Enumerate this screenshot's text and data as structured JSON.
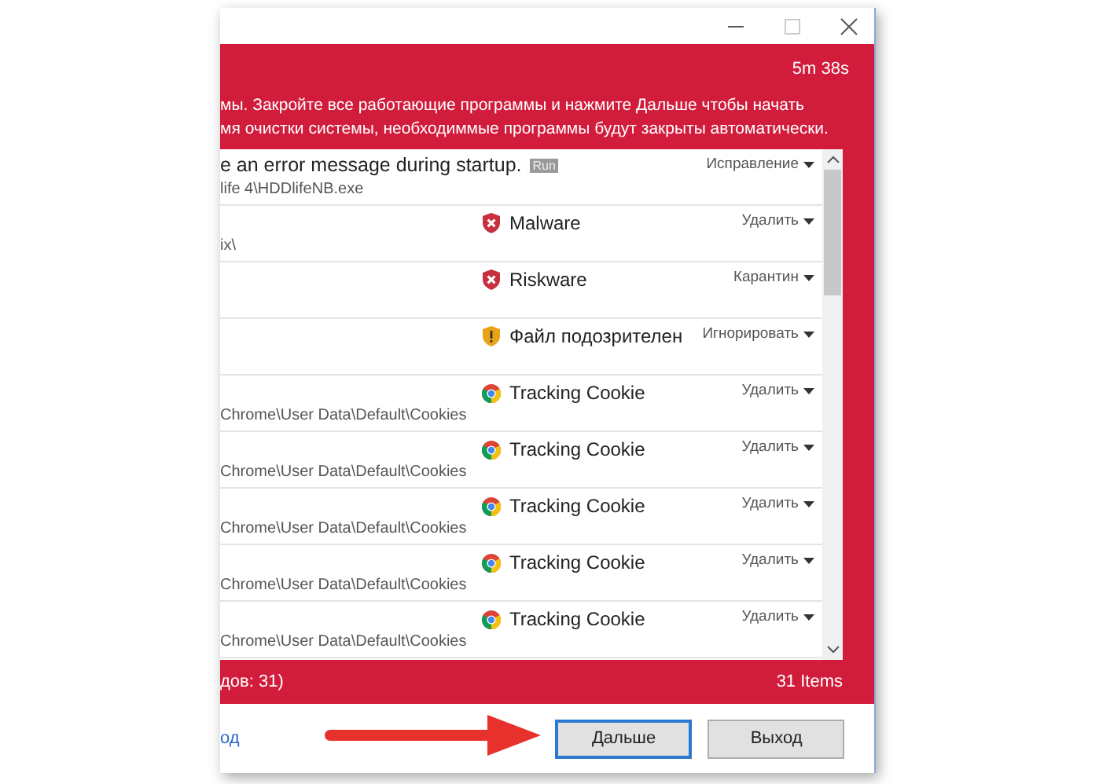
{
  "timer": "5m 38s",
  "message_lines": [
    "мы. Закройте все работающие программы и нажмите Дальше чтобы начать",
    "мя очистки системы, необходиммые программы будут закрыты автоматически."
  ],
  "items": [
    {
      "kind": "error",
      "title": "e an error message during startup.",
      "badge": "Run",
      "path": "life 4\\HDDlifeNB.exe",
      "action": "Исправление"
    },
    {
      "kind": "malware",
      "threat": "Malware",
      "path": "ix\\",
      "action": "Удалить"
    },
    {
      "kind": "malware",
      "threat": "Riskware",
      "action": "Карантин"
    },
    {
      "kind": "warning",
      "threat": "Файл подозрителен",
      "action": "Игнорировать"
    },
    {
      "kind": "browser",
      "threat": "Tracking Cookie",
      "path": "Chrome\\User Data\\Default\\Cookies",
      "action": "Удалить"
    },
    {
      "kind": "browser",
      "threat": "Tracking Cookie",
      "path": "Chrome\\User Data\\Default\\Cookies",
      "action": "Удалить"
    },
    {
      "kind": "browser",
      "threat": "Tracking Cookie",
      "path": "Chrome\\User Data\\Default\\Cookies",
      "action": "Удалить"
    },
    {
      "kind": "browser",
      "threat": "Tracking Cookie",
      "path": "Chrome\\User Data\\Default\\Cookies",
      "action": "Удалить"
    },
    {
      "kind": "browser",
      "threat": "Tracking Cookie",
      "path": "Chrome\\User Data\\Default\\Cookies",
      "action": "Удалить"
    }
  ],
  "summary": "дов: 31)",
  "count": "31 Items",
  "link": "од",
  "buttons": [
    {
      "label": "Дальше",
      "selected": true
    },
    {
      "label": "Выход",
      "selected": false
    }
  ]
}
